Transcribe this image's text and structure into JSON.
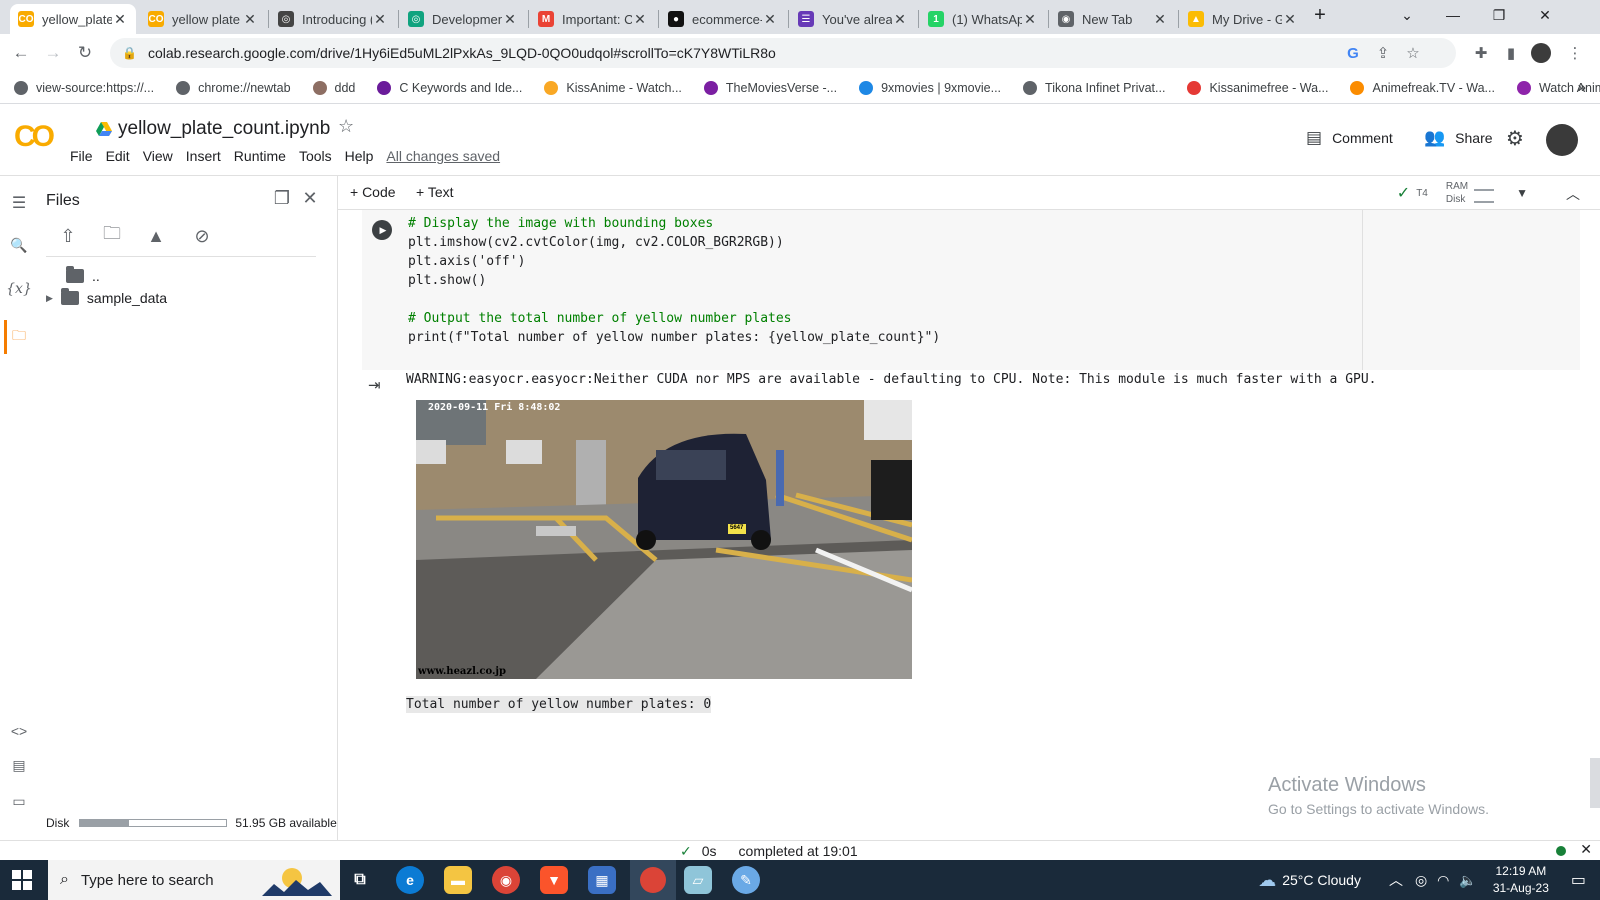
{
  "browser": {
    "tabs": [
      {
        "label": "yellow_plate_",
        "fav": "CO",
        "color": "#f9ab00",
        "active": true
      },
      {
        "label": "yellow plate",
        "fav": "CO",
        "color": "#f9ab00"
      },
      {
        "label": "Introducing (",
        "fav": "◎",
        "color": "#444"
      },
      {
        "label": "Developmen",
        "fav": "◎",
        "color": "#10a37f"
      },
      {
        "label": "Important: C",
        "fav": "M",
        "color": "#ea4335"
      },
      {
        "label": "ecommerce-",
        "fav": "●",
        "color": "#111"
      },
      {
        "label": "You've alreac",
        "fav": "☰",
        "color": "#673ab7"
      },
      {
        "label": "(1) WhatsAp",
        "fav": "1",
        "color": "#25d366"
      },
      {
        "label": "New Tab",
        "fav": "◉",
        "color": "#5f6368"
      },
      {
        "label": "My Drive - G",
        "fav": "▲",
        "color": "#fbbc04"
      }
    ],
    "url": "colab.research.google.com/drive/1Hy6iEd5uML2lPxkAs_9LQD-0QO0udqol#scrollTo=cK7Y8WTiLR8o",
    "bookmarks": [
      {
        "label": "view-source:https://...",
        "color": "#5f6368"
      },
      {
        "label": "chrome://newtab",
        "color": "#5f6368"
      },
      {
        "label": "ddd",
        "color": "#8d6e63"
      },
      {
        "label": "C Keywords and Ide...",
        "color": "#6a1b9a"
      },
      {
        "label": "KissAnime - Watch...",
        "color": "#f9a825"
      },
      {
        "label": "TheMoviesVerse -...",
        "color": "#7b1fa2"
      },
      {
        "label": "9xmovies | 9xmovie...",
        "color": "#1e88e5"
      },
      {
        "label": "Tikona Infinet Privat...",
        "color": "#5f6368"
      },
      {
        "label": "Kissanimefree - Wa...",
        "color": "#e53935"
      },
      {
        "label": "Animefreak.TV - Wa...",
        "color": "#fb8c00"
      },
      {
        "label": "Watch Anime Onlin...",
        "color": "#8e24aa"
      }
    ]
  },
  "colab": {
    "title": "yellow_plate_count.ipynb",
    "menus": [
      "File",
      "Edit",
      "View",
      "Insert",
      "Runtime",
      "Tools",
      "Help"
    ],
    "saved_status": "All changes saved",
    "comment_label": "Comment",
    "share_label": "Share",
    "add_code": "+ Code",
    "add_text": "+ Text",
    "runtime": {
      "check": "✓",
      "gpu": "T4",
      "ram": "RAM",
      "disk": "Disk"
    }
  },
  "files": {
    "title": "Files",
    "parent_label": "..",
    "folder": "sample_data",
    "disk_label": "Disk",
    "disk_available": "51.95 GB available",
    "disk_used_fraction": 0.33
  },
  "cell": {
    "code_lines": [
      {
        "t": "# Display the image with bounding boxes",
        "k": "com"
      },
      {
        "t": "plt.imshow(cv2.cvtColor(img, cv2.COLOR_BGR2RGB))",
        "k": "fn"
      },
      {
        "t": "plt.axis('off')",
        "k": "fn"
      },
      {
        "t": "plt.show()",
        "k": "fn"
      },
      {
        "t": "",
        "k": "fn"
      },
      {
        "t": "# Output the total number of yellow number plates",
        "k": "com"
      },
      {
        "t": "print(f\"Total number of yellow number plates: {yellow_plate_count}\")",
        "k": "fn"
      }
    ],
    "warning": "WARNING:easyocr.easyocr:Neither CUDA nor MPS are available - defaulting to CPU. Note: This module is much faster with a GPU.",
    "image_timestamp": "2020-09-11 Fri  8:48:02",
    "image_watermark": "www.heazl.co.jp",
    "plate_text": "5647",
    "result": "Total number of yellow number plates: 0"
  },
  "watermark": {
    "line1": "Activate Windows",
    "line2": "Go to Settings to activate Windows."
  },
  "status": {
    "check": "✓",
    "duration": "0s",
    "completed": "completed at 19:01"
  },
  "taskbar": {
    "search_placeholder": "Type here to search",
    "weather": "25°C  Cloudy",
    "time": "12:19 AM",
    "date": "31-Aug-23"
  }
}
